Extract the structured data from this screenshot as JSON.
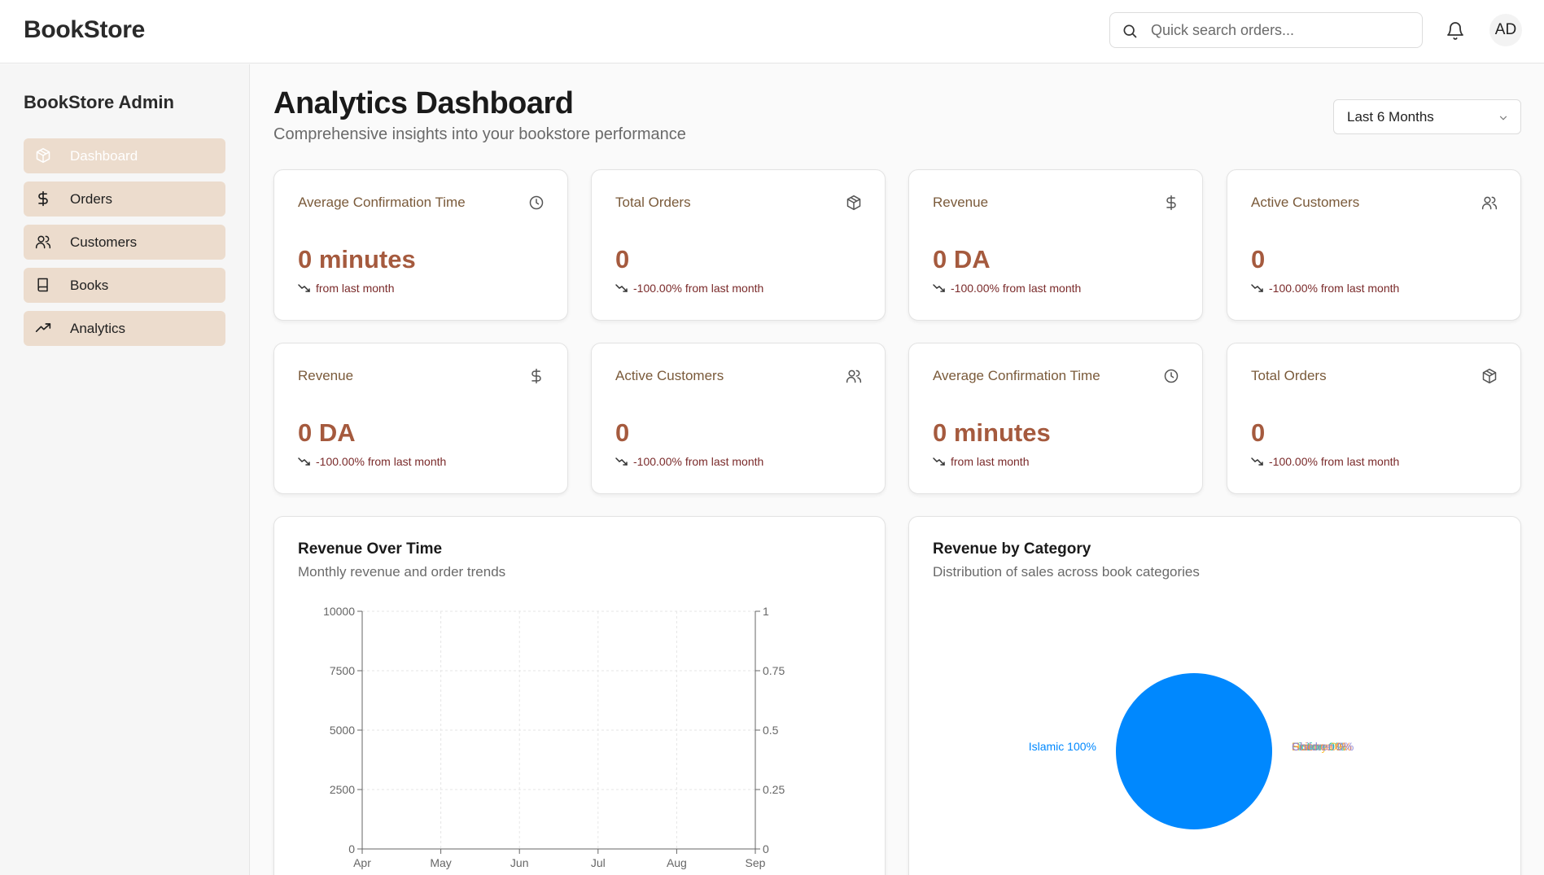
{
  "header": {
    "brand": "BookStore",
    "search_placeholder": "Quick search orders...",
    "avatar_initials": "AD"
  },
  "sidebar": {
    "title": "BookStore Admin",
    "items": [
      {
        "label": "Dashboard",
        "icon": "package-icon",
        "active": true
      },
      {
        "label": "Orders",
        "icon": "dollar-icon",
        "active": false
      },
      {
        "label": "Customers",
        "icon": "users-icon",
        "active": false
      },
      {
        "label": "Books",
        "icon": "book-icon",
        "active": false
      },
      {
        "label": "Analytics",
        "icon": "trending-up-icon",
        "active": false
      }
    ]
  },
  "main": {
    "title": "Analytics Dashboard",
    "subtitle": "Comprehensive insights into your bookstore performance",
    "range_select": "Last 6 Months",
    "cards": [
      {
        "title": "Average Confirmation Time",
        "icon": "clock-icon",
        "value": "0 minutes",
        "trend": "from last month"
      },
      {
        "title": "Total Orders",
        "icon": "package-icon",
        "value": "0",
        "trend": "-100.00% from last month"
      },
      {
        "title": "Revenue",
        "icon": "dollar-icon",
        "value": "0 DA",
        "trend": "-100.00% from last month"
      },
      {
        "title": "Active Customers",
        "icon": "users-icon",
        "value": "0",
        "trend": "-100.00% from last month"
      },
      {
        "title": "Revenue",
        "icon": "dollar-icon",
        "value": "0 DA",
        "trend": "-100.00% from last month"
      },
      {
        "title": "Active Customers",
        "icon": "users-icon",
        "value": "0",
        "trend": "-100.00% from last month"
      },
      {
        "title": "Average Confirmation Time",
        "icon": "clock-icon",
        "value": "0 minutes",
        "trend": "from last month"
      },
      {
        "title": "Total Orders",
        "icon": "package-icon",
        "value": "0",
        "trend": "-100.00% from last month"
      }
    ],
    "revenue_panel": {
      "title": "Revenue Over Time",
      "subtitle": "Monthly revenue and order trends"
    },
    "category_panel": {
      "title": "Revenue by Category",
      "subtitle": "Distribution of sales across book categories"
    }
  },
  "colors": {
    "accent": "#a55a3e",
    "nav_bg": "#ecdccd",
    "card_title": "#7a5a3a",
    "trend": "#7a2a2a",
    "pie_blue": "#0088fe"
  },
  "chart_data": [
    {
      "type": "line",
      "title": "Revenue Over Time",
      "categories": [
        "Apr",
        "May",
        "Jun",
        "Jul",
        "Aug",
        "Sep"
      ],
      "y_left": {
        "ticks": [
          "0",
          "2500",
          "5000",
          "7500",
          "10000"
        ],
        "ylim": [
          0,
          10000
        ]
      },
      "y_right": {
        "ticks": [
          "0",
          "0.25",
          "0.5",
          "0.75",
          "1"
        ],
        "ylim": [
          0,
          1
        ]
      },
      "grid": true,
      "series": []
    },
    {
      "type": "pie",
      "title": "Revenue by Category",
      "slices": [
        {
          "label": "Islamic 100%",
          "value": 100,
          "color": "#0088fe"
        }
      ],
      "overlapping_labels": [
        {
          "label": "Fiction 0%",
          "color": "#00c49f"
        },
        {
          "label": "History 0%",
          "color": "#ffbb28"
        },
        {
          "label": "Science 0%",
          "color": "#ff8042"
        },
        {
          "label": "Children 0%",
          "color": "#8884d8"
        }
      ]
    }
  ]
}
